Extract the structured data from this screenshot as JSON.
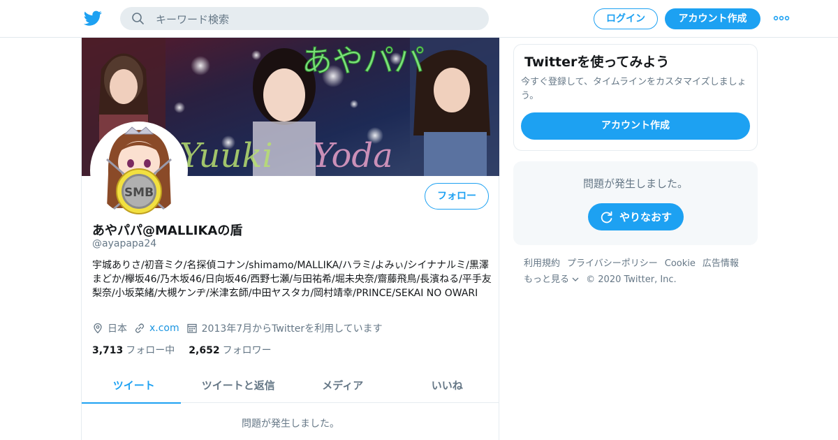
{
  "colors": {
    "accent": "#1da1f2",
    "muted": "#657786",
    "text": "#14171a",
    "border": "#e6ecf0"
  },
  "header": {
    "logo_icon": "twitter-bird-icon",
    "search": {
      "placeholder": "キーワード検索",
      "icon": "search-icon"
    },
    "login_label": "ログイン",
    "signup_label": "アカウント作成",
    "more_icon": "more-dots-icon"
  },
  "profile": {
    "banner_text": "あやパパ",
    "banner_script_left": "Yuuki",
    "banner_script_right": "Yoda",
    "avatar_text": "SMB",
    "follow_label": "フォロー",
    "display_name": "あやパパ@MALLIKAの盾",
    "handle": "@ayapapa24",
    "bio": "宇城ありさ/初音ミク/名探偵コナン/shimamo/MALLIKA/ハラミ/よみぃ/シイナナルミ/黒澤まどか/欅坂46/乃木坂46/日向坂46/西野七瀬/与田祐希/堀未央奈/齋藤飛鳥/長濱ねる/平手友梨奈/小坂菜緒/大槻ケンヂ/米津玄師/中田ヤスタカ/岡村靖幸/PRINCE/SEKAI NO OWARI",
    "location": "日本",
    "url": "x.com",
    "joined": "2013年7月からTwitterを利用しています",
    "following_count": "3,713",
    "following_label": "フォロー中",
    "followers_count": "2,652",
    "followers_label": "フォロワー"
  },
  "tabs": [
    {
      "label": "ツイート",
      "active": true
    },
    {
      "label": "ツイートと返信",
      "active": false
    },
    {
      "label": "メディア",
      "active": false
    },
    {
      "label": "いいね",
      "active": false
    }
  ],
  "timeline": {
    "error": "問題が発生しました。"
  },
  "sidebar": {
    "signup_card": {
      "title": "Twitterを使ってみよう",
      "description": "今すぐ登録して、タイムラインをカスタマイズしましょう。",
      "button": "アカウント作成"
    },
    "error_card": {
      "message": "問題が発生しました。",
      "retry_label": "やりなおす"
    },
    "footer": {
      "links": [
        "利用規約",
        "プライバシーポリシー",
        "Cookie",
        "広告情報"
      ],
      "more": "もっと見る",
      "copyright": "© 2020 Twitter, Inc."
    }
  }
}
